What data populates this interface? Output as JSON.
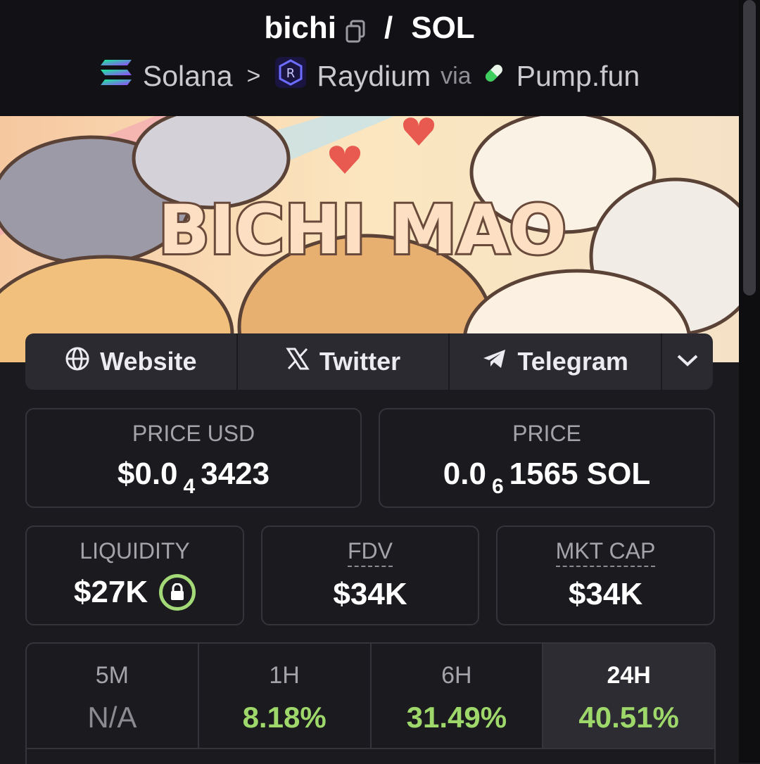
{
  "header": {
    "token": "bichi",
    "quote": "SOL",
    "chain": "Solana",
    "dex": "Raydium",
    "via_label": "via",
    "launchpad": "Pump.fun"
  },
  "banner": {
    "text": "BICHI MAO"
  },
  "links": {
    "website": "Website",
    "twitter": "Twitter",
    "telegram": "Telegram"
  },
  "price_usd": {
    "label": "PRICE USD",
    "prefix": "$0.0",
    "zeros": "4",
    "digits": "3423"
  },
  "price_native": {
    "label": "PRICE",
    "prefix": "0.0",
    "zeros": "6",
    "digits": "1565 SOL"
  },
  "liquidity": {
    "label": "LIQUIDITY",
    "value": "$27K"
  },
  "fdv": {
    "label": "FDV",
    "value": "$34K"
  },
  "mkt_cap": {
    "label": "MKT CAP",
    "value": "$34K"
  },
  "periods": [
    {
      "label": "5M",
      "value": "N/A"
    },
    {
      "label": "1H",
      "value": "8.18%"
    },
    {
      "label": "6H",
      "value": "31.49%"
    },
    {
      "label": "24H",
      "value": "40.51%"
    }
  ],
  "colors": {
    "positive": "#9ed86a",
    "lock_ring": "#a3d977",
    "background": "#1b1b1f"
  }
}
